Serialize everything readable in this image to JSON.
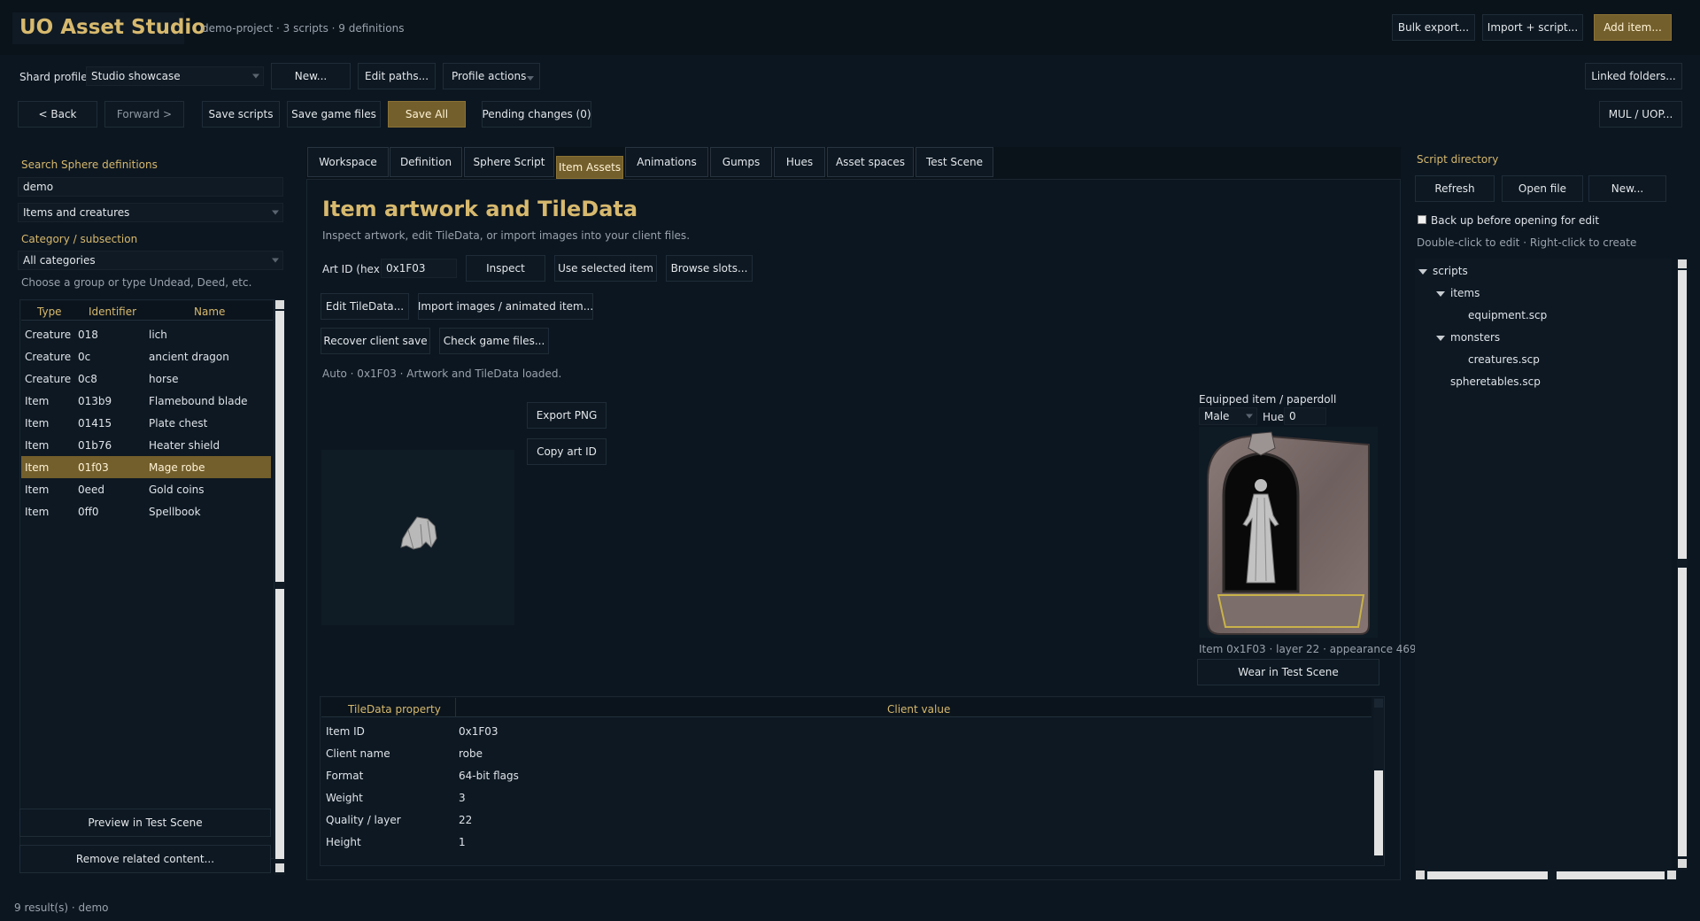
{
  "header": {
    "app_title": "UO Asset Studio",
    "project_info": "demo-project · 3 scripts · 9 definitions",
    "bulk_export": "Bulk export...",
    "import_script": "Import + script...",
    "add_item": "Add item..."
  },
  "profile": {
    "label": "Shard profile",
    "selected": "Studio showcase",
    "new_btn": "New...",
    "edit_paths": "Edit paths...",
    "profile_actions": "Profile actions",
    "linked_folders": "Linked folders..."
  },
  "toolbar": {
    "back": "< Back",
    "forward": "Forward >",
    "save_scripts": "Save scripts",
    "save_game_files": "Save game files",
    "save_all": "Save All",
    "pending_changes": "Pending changes (0)",
    "mul_uop": "MUL / UOP..."
  },
  "left": {
    "search_label": "Search Sphere definitions",
    "search_value": "demo",
    "filter_selected": "Items and creatures",
    "category_label": "Category / subsection",
    "category_selected": "All categories",
    "category_hint": "Choose a group or type Undead, Deed, etc.",
    "columns": [
      "Type",
      "Identifier",
      "Name"
    ],
    "rows": [
      {
        "type": "Creature",
        "id": "018",
        "name": "lich"
      },
      {
        "type": "Creature",
        "id": "0c",
        "name": "ancient dragon"
      },
      {
        "type": "Creature",
        "id": "0c8",
        "name": "horse"
      },
      {
        "type": "Item",
        "id": "013b9",
        "name": "Flamebound blade"
      },
      {
        "type": "Item",
        "id": "01415",
        "name": "Plate chest"
      },
      {
        "type": "Item",
        "id": "01b76",
        "name": "Heater shield"
      },
      {
        "type": "Item",
        "id": "01f03",
        "name": "Mage robe"
      },
      {
        "type": "Item",
        "id": "0eed",
        "name": "Gold coins"
      },
      {
        "type": "Item",
        "id": "0ff0",
        "name": "Spellbook"
      }
    ],
    "selected_index": 6,
    "preview_btn": "Preview in Test Scene",
    "remove_btn": "Remove related content..."
  },
  "tabs": [
    "Workspace",
    "Definition",
    "Sphere Script",
    "Item Assets",
    "Animations",
    "Gumps",
    "Hues",
    "Asset spaces",
    "Test Scene"
  ],
  "active_tab": "Item Assets",
  "main": {
    "title": "Item artwork and TileData",
    "subtitle": "Inspect artwork, edit TileData, or import images into your client files.",
    "art_id_label": "Art ID (hex)",
    "art_id_value": "0x1F03",
    "inspect_btn": "Inspect",
    "use_selected_btn": "Use selected item",
    "browse_slots_btn": "Browse slots...",
    "edit_tiledata_btn": "Edit TileData...",
    "import_images_btn": "Import images / animated item...",
    "recover_btn": "Recover client save",
    "check_files_btn": "Check game files...",
    "status": "Auto · 0x1F03 · Artwork and TileData loaded.",
    "export_png_btn": "Export PNG",
    "copy_art_btn": "Copy art ID",
    "paperdoll": {
      "label": "Equipped item / paperdoll",
      "gender": "Male",
      "hue_label": "Hue",
      "hue_value": "0",
      "caption": "Item 0x1F03 · layer 22 · appearance 469",
      "wear_btn": "Wear in Test Scene"
    },
    "tiledata": {
      "columns": [
        "TileData property",
        "Client value"
      ],
      "rows": [
        {
          "prop": "Item ID",
          "value": "0x1F03"
        },
        {
          "prop": "Client name",
          "value": "robe"
        },
        {
          "prop": "Format",
          "value": "64-bit flags"
        },
        {
          "prop": "Weight",
          "value": "3"
        },
        {
          "prop": "Quality / layer",
          "value": "22"
        },
        {
          "prop": "Height",
          "value": "1"
        }
      ]
    }
  },
  "right": {
    "title": "Script directory",
    "refresh": "Refresh",
    "open_file": "Open file",
    "new": "New...",
    "backup_label": "Back up before opening for edit",
    "hint": "Double-click to edit · Right-click to create",
    "tree": {
      "root": "scripts",
      "items_folder": "items",
      "equipment": "equipment.scp",
      "monsters_folder": "monsters",
      "creatures": "creatures.scp",
      "spheretables": "spheretables.scp"
    }
  },
  "statusbar": {
    "text": "9 result(s) · demo"
  },
  "colors": {
    "accent": "#735f2c",
    "gold_text": "#d7b96e",
    "background": "#0c1620"
  }
}
